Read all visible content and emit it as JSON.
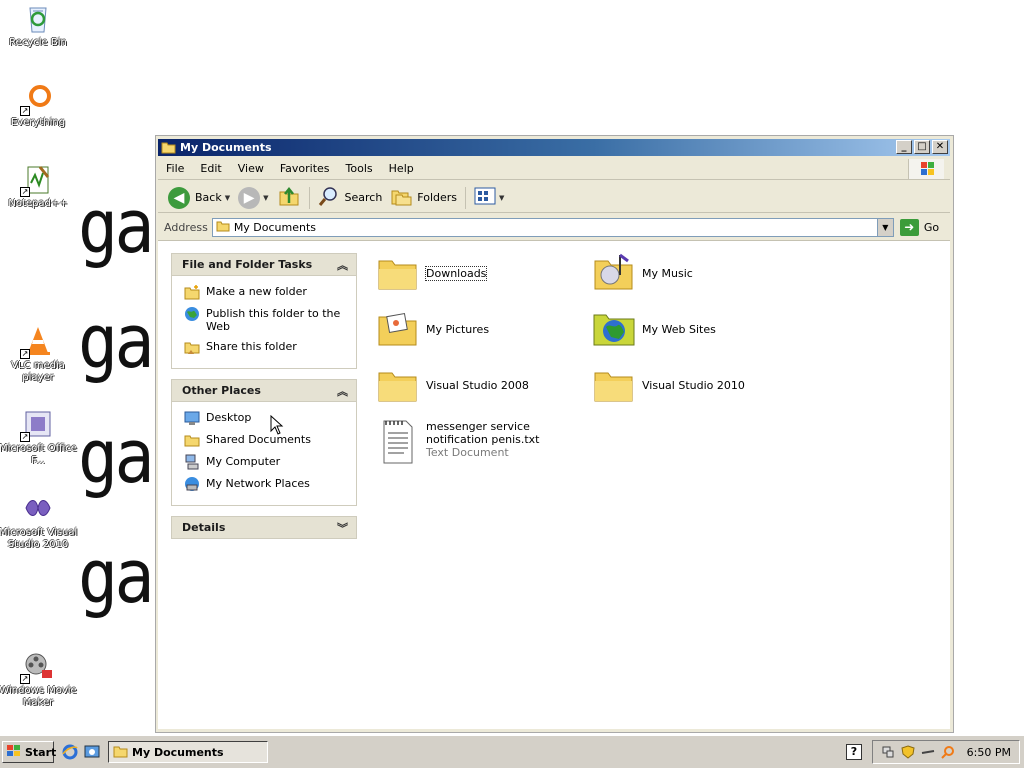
{
  "desktop": {
    "icons": [
      {
        "label": "Recycle Bin",
        "icon": "recycle-bin-icon"
      },
      {
        "label": "Everything",
        "icon": "search-ring-icon"
      },
      {
        "label": "Notepad++",
        "icon": "notepad-icon"
      },
      {
        "label": "VLC media player",
        "icon": "vlc-cone-icon"
      },
      {
        "label": "Microsoft Office F...",
        "icon": "office-icon"
      },
      {
        "label": "Microsoft Visual Studio 2010",
        "icon": "visual-studio-icon"
      },
      {
        "label": "Windows Movie Maker",
        "icon": "movie-reel-icon"
      }
    ],
    "wallpaper_word": "ga"
  },
  "window": {
    "title": "My Documents",
    "buttons": {
      "minimize": "_",
      "maximize": "□",
      "close": "✕"
    },
    "menu": [
      "File",
      "Edit",
      "View",
      "Favorites",
      "Tools",
      "Help"
    ],
    "toolbar": {
      "back": "Back",
      "search": "Search",
      "folders": "Folders"
    },
    "address": {
      "label": "Address",
      "value": "My Documents",
      "go": "Go"
    }
  },
  "taskpane": {
    "file_folder_tasks": {
      "title": "File and Folder Tasks",
      "items": [
        {
          "label": "Make a new folder",
          "icon": "new-folder-icon"
        },
        {
          "label": "Publish this folder to the Web",
          "icon": "globe-publish-icon"
        },
        {
          "label": "Share this folder",
          "icon": "share-folder-icon"
        }
      ]
    },
    "other_places": {
      "title": "Other Places",
      "items": [
        {
          "label": "Desktop",
          "icon": "desktop-icon"
        },
        {
          "label": "Shared Documents",
          "icon": "folder-icon"
        },
        {
          "label": "My Computer",
          "icon": "computer-icon"
        },
        {
          "label": "My Network Places",
          "icon": "network-icon"
        }
      ]
    },
    "details": {
      "title": "Details"
    }
  },
  "files": [
    {
      "name": "Downloads",
      "type": "folder"
    },
    {
      "name": "My Music",
      "type": "music-folder"
    },
    {
      "name": "My Pictures",
      "type": "pictures-folder"
    },
    {
      "name": "My Web Sites",
      "type": "web-folder"
    },
    {
      "name": "Visual Studio 2008",
      "type": "folder"
    },
    {
      "name": "Visual Studio 2010",
      "type": "folder"
    },
    {
      "name": "messenger service notification penis.txt",
      "type": "text-file",
      "subtitle": "Text Document"
    }
  ],
  "taskbar": {
    "start": "Start",
    "task": "My Documents",
    "clock": "6:50 PM",
    "help": "?"
  },
  "colors": {
    "titlebar_start": "#0a246a",
    "titlebar_end": "#a6caf0",
    "folder": "#f5d76e",
    "panel_head": "#e5e2d3"
  }
}
